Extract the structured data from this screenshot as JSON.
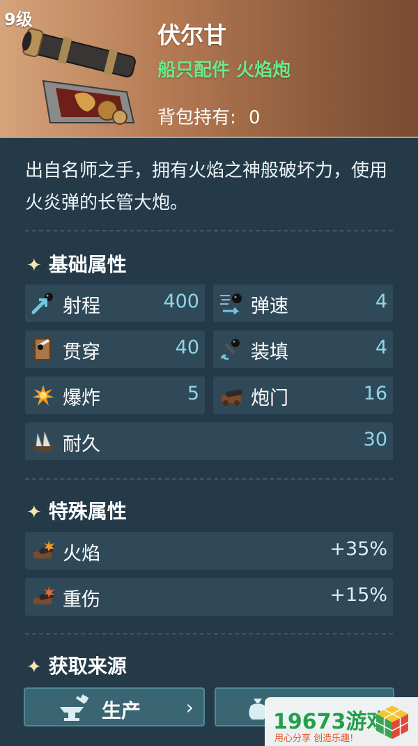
{
  "header": {
    "level": "9级",
    "title": "伏尔甘",
    "subtitle": "船只配件 火焰炮",
    "holding_label": "背包持有:",
    "holding_value": "0",
    "item_icon": "cannon-icon"
  },
  "description": "出自名师之手，拥有火焰之神般破坏力，使用火炎弹的长管大炮。",
  "sections": {
    "basic": {
      "star": "✦",
      "title": "基础属性"
    },
    "special": {
      "star": "✦",
      "title": "特殊属性"
    },
    "source": {
      "star": "✦",
      "title": "获取来源"
    }
  },
  "basic_stats": [
    {
      "label": "射程",
      "value": "400",
      "icon": "range-icon"
    },
    {
      "label": "弹速",
      "value": "4",
      "icon": "bullet-speed-icon"
    },
    {
      "label": "贯穿",
      "value": "40",
      "icon": "penetration-icon"
    },
    {
      "label": "装填",
      "value": "4",
      "icon": "reload-icon"
    },
    {
      "label": "爆炸",
      "value": "5",
      "icon": "explosion-icon"
    },
    {
      "label": "炮门",
      "value": "16",
      "icon": "gun-port-icon"
    },
    {
      "label": "耐久",
      "value": "30",
      "icon": "durability-icon"
    }
  ],
  "special_stats": [
    {
      "label": "火焰",
      "value": "+35%",
      "icon": "fire-cannon-icon"
    },
    {
      "label": "重伤",
      "value": "+15%",
      "icon": "heavy-wound-icon"
    }
  ],
  "source_buttons": [
    {
      "label": "生产",
      "icon": "anvil-icon",
      "chevron": "›"
    },
    {
      "label": "",
      "icon": "bag-icon"
    }
  ],
  "watermark": {
    "text": "19673游戏",
    "sub": "用心分享 创造乐趣!"
  },
  "colors": {
    "header_bg": "#b47a53",
    "panel_bg": "#243a49",
    "subtitle_green": "#6de78c",
    "stat_value": "#8fd6e6",
    "button_bg": "#3a6674"
  }
}
